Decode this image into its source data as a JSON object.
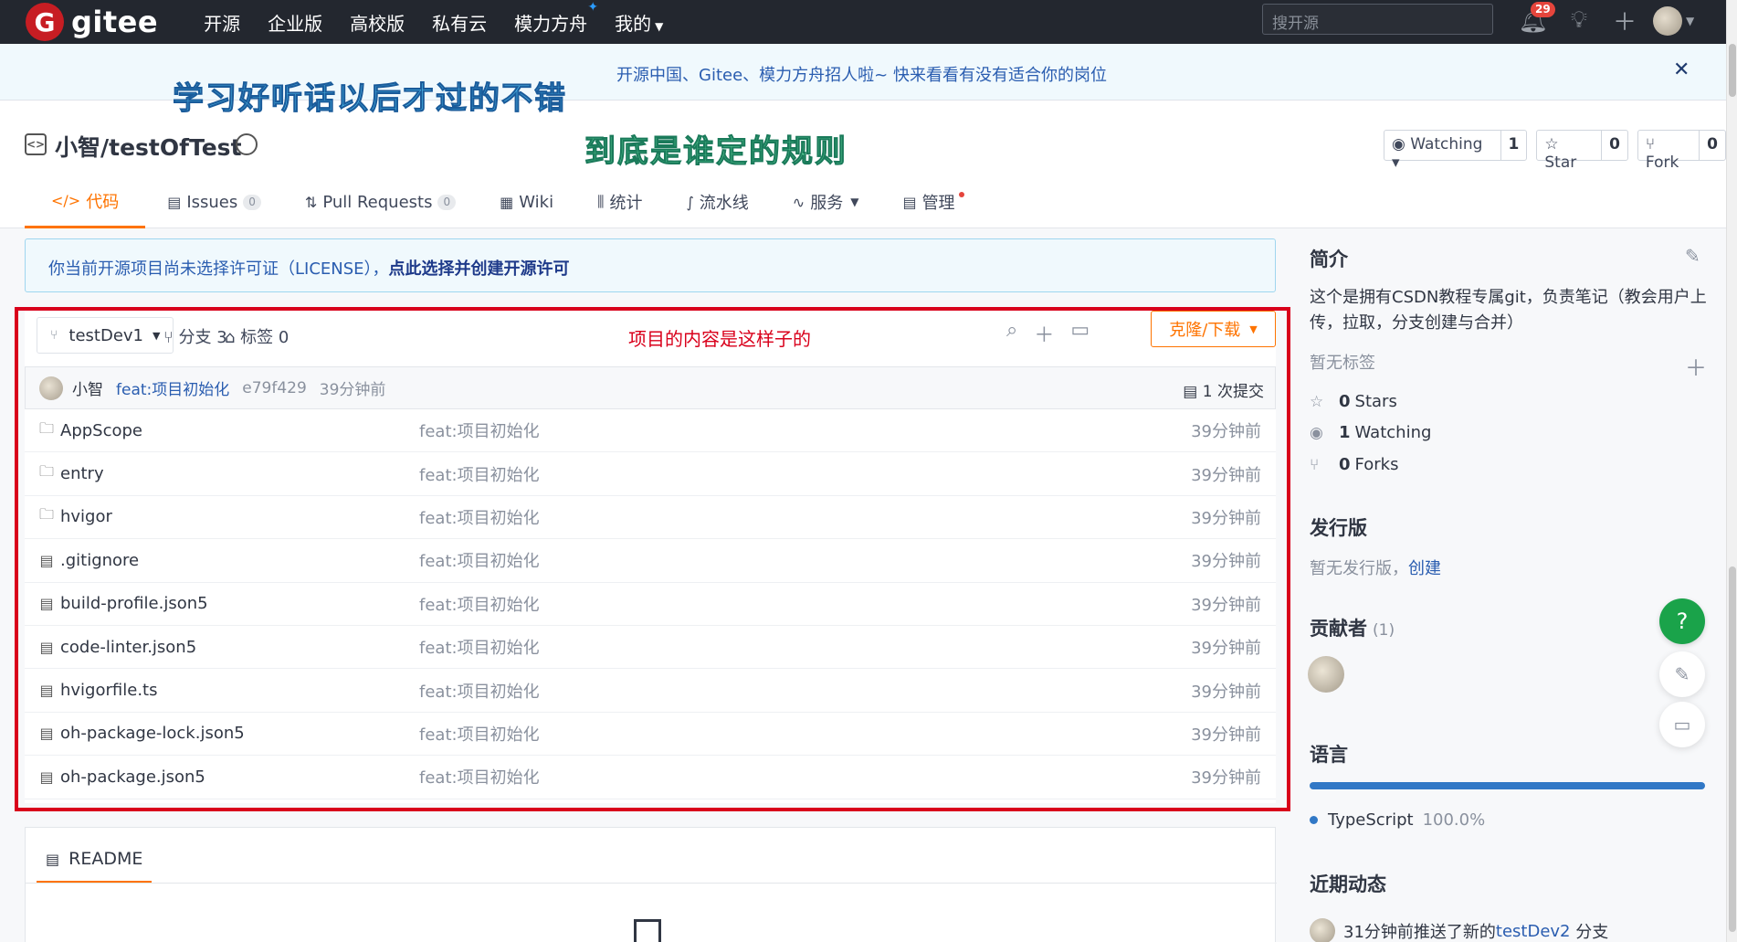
{
  "topnav": {
    "logo_mark": "G",
    "logo_text": "gitee",
    "links": [
      "开源",
      "企业版",
      "高校版",
      "私有云",
      "模力方舟",
      "我的"
    ],
    "spark": "✦",
    "search_placeholder": "搜开源",
    "notification_count": "29"
  },
  "announcement": {
    "text": "开源中国、Gitee、模力方舟招人啦~ 快来看看有没有适合你的岗位",
    "close": "✕"
  },
  "overlay_texts": [
    "学习好听话以后才过的不错",
    "到底是谁定的规则"
  ],
  "repo": {
    "title": "小智/testOfTest",
    "watching_label": "Watching",
    "watching_count": "1",
    "star_label": "Star",
    "star_count": "0",
    "fork_label": "Fork",
    "fork_count": "0"
  },
  "tabs": [
    {
      "label": "代码",
      "icon": "</>"
    },
    {
      "label": "Issues",
      "count": "0"
    },
    {
      "label": "Pull Requests",
      "count": "0"
    },
    {
      "label": "Wiki"
    },
    {
      "label": "统计"
    },
    {
      "label": "流水线"
    },
    {
      "label": "服务"
    },
    {
      "label": "管理"
    }
  ],
  "license": {
    "text": "你当前开源项目尚未选择许可证（LICENSE），",
    "link": "点此选择并创建开源许可"
  },
  "files_panel": {
    "branch": "testDev1",
    "branches": "分支 3",
    "tags": "标签 0",
    "note": "项目的内容是这样子的",
    "clone_label": "克隆/下载",
    "commit": {
      "author": "小智",
      "message": "feat:项目初始化",
      "hash": "e79f429",
      "time": "39分钟前",
      "count": "1 次提交"
    },
    "files": [
      {
        "name": "AppScope",
        "type": "folder",
        "commit": "feat:项目初始化",
        "time": "39分钟前"
      },
      {
        "name": "entry",
        "type": "folder",
        "commit": "feat:项目初始化",
        "time": "39分钟前"
      },
      {
        "name": "hvigor",
        "type": "folder",
        "commit": "feat:项目初始化",
        "time": "39分钟前"
      },
      {
        "name": ".gitignore",
        "type": "file",
        "commit": "feat:项目初始化",
        "time": "39分钟前"
      },
      {
        "name": "build-profile.json5",
        "type": "file",
        "commit": "feat:项目初始化",
        "time": "39分钟前"
      },
      {
        "name": "code-linter.json5",
        "type": "file",
        "commit": "feat:项目初始化",
        "time": "39分钟前"
      },
      {
        "name": "hvigorfile.ts",
        "type": "file",
        "commit": "feat:项目初始化",
        "time": "39分钟前"
      },
      {
        "name": "oh-package-lock.json5",
        "type": "file",
        "commit": "feat:项目初始化",
        "time": "39分钟前"
      },
      {
        "name": "oh-package.json5",
        "type": "file",
        "commit": "feat:项目初始化",
        "time": "39分钟前"
      }
    ]
  },
  "readme": {
    "label": "README"
  },
  "sidebar": {
    "intro_title": "简介",
    "intro_text": "这个是拥有CSDN教程专属git，负责笔记（教会用户上传，拉取，分支创建与合并）",
    "no_tags": "暂无标签",
    "stars": {
      "count": "0",
      "label": "Stars"
    },
    "watching": {
      "count": "1",
      "label": "Watching"
    },
    "forks": {
      "count": "0",
      "label": "Forks"
    },
    "release_title": "发行版",
    "no_release": "暂无发行版，",
    "create_link": "创建",
    "contributors_title": "贡献者",
    "contributors_count": "(1)",
    "language_title": "语言",
    "language": {
      "name": "TypeScript",
      "percent": "100.0%",
      "color": "#3178c6",
      "share": 1.0
    },
    "activity_title": "近期动态",
    "activity_text": "31分钟前推送了新的",
    "activity_branch": "testDev2",
    "activity_suffix": "分支"
  },
  "floating": {
    "help": "?"
  },
  "colors": {
    "accent": "#fe7300",
    "nav_bg": "#23272f",
    "link": "#2a5db0",
    "highlight_border": "#d9001b",
    "success": "#1aa34a"
  }
}
